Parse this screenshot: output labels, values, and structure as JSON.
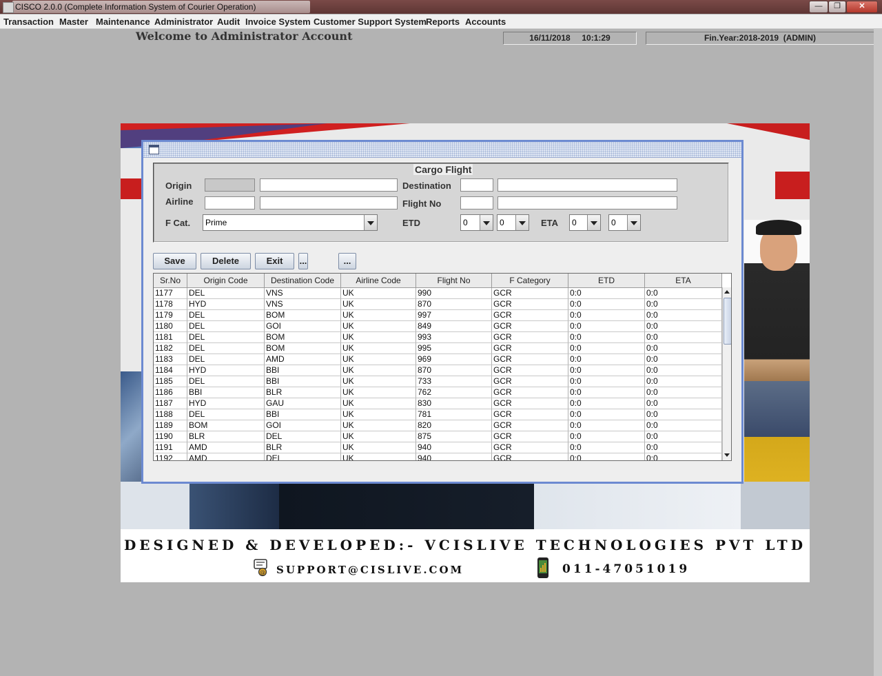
{
  "window": {
    "title": "CISCO 2.0.0 (Complete Information System of Courier Operation)",
    "minimize_icon": "minimize-icon",
    "restore_icon": "restore-icon",
    "close_icon": "close-icon"
  },
  "menu": [
    "Transaction",
    "Master",
    "Maintenance",
    "Administrator",
    "Audit",
    "Invoice System",
    "Customer Support System",
    "Reports",
    "Accounts"
  ],
  "welcome": "Welcome to Administrator Account",
  "datetime": "16/11/2018     10:1:29",
  "finyear": "Fin.Year:2018-2019  (ADMIN)",
  "banner": {
    "designed": "DESIGNED & DEVELOPED:- VCISLIVE TECHNOLOGIES PVT LTD",
    "email": "SUPPORT@CISLIVE.COM",
    "phone": "011-47051019"
  },
  "form": {
    "legend": "Cargo Flight",
    "labels": {
      "origin": "Origin",
      "destination": "Destination",
      "airline": "Airline",
      "flight_no": "Flight No",
      "fcat": "F Cat.",
      "etd": "ETD",
      "eta": "ETA"
    },
    "fcat_value": "Prime",
    "etd_hour": "0",
    "etd_min": "0",
    "eta_hour": "0",
    "eta_min": "0",
    "buttons": {
      "save": "Save",
      "delete": "Delete",
      "exit": "Exit",
      "more1": "...",
      "more2": "..."
    }
  },
  "table": {
    "columns": [
      "Sr.No",
      "Origin Code",
      "Destination Code",
      "Airline Code",
      "Flight No",
      "F Category",
      "ETD",
      "ETA"
    ],
    "rows": [
      [
        "1177",
        "DEL",
        "VNS",
        "UK",
        "990",
        "GCR",
        "0:0",
        "0:0"
      ],
      [
        "1178",
        "HYD",
        "VNS",
        "UK",
        "870",
        "GCR",
        "0:0",
        "0:0"
      ],
      [
        "1179",
        "DEL",
        "BOM",
        "UK",
        "997",
        "GCR",
        "0:0",
        "0:0"
      ],
      [
        "1180",
        "DEL",
        "GOI",
        "UK",
        "849",
        "GCR",
        "0:0",
        "0:0"
      ],
      [
        "1181",
        "DEL",
        "BOM",
        "UK",
        "993",
        "GCR",
        "0:0",
        "0:0"
      ],
      [
        "1182",
        "DEL",
        "BOM",
        "UK",
        "995",
        "GCR",
        "0:0",
        "0:0"
      ],
      [
        "1183",
        "DEL",
        "AMD",
        "UK",
        "969",
        "GCR",
        "0:0",
        "0:0"
      ],
      [
        "1184",
        "HYD",
        "BBI",
        "UK",
        "870",
        "GCR",
        "0:0",
        "0:0"
      ],
      [
        "1185",
        "DEL",
        "BBI",
        "UK",
        "733",
        "GCR",
        "0:0",
        "0:0"
      ],
      [
        "1186",
        "BBI",
        "BLR",
        "UK",
        "762",
        "GCR",
        "0:0",
        "0:0"
      ],
      [
        "1187",
        "HYD",
        "GAU",
        "UK",
        "830",
        "GCR",
        "0:0",
        "0:0"
      ],
      [
        "1188",
        "DEL",
        "BBI",
        "UK",
        "781",
        "GCR",
        "0:0",
        "0:0"
      ],
      [
        "1189",
        "BOM",
        "GOI",
        "UK",
        "820",
        "GCR",
        "0:0",
        "0:0"
      ],
      [
        "1190",
        "BLR",
        "DEL",
        "UK",
        "875",
        "GCR",
        "0:0",
        "0:0"
      ],
      [
        "1191",
        "AMD",
        "BLR",
        "UK",
        "940",
        "GCR",
        "0:0",
        "0:0"
      ],
      [
        "1192",
        "AMD",
        "DEL",
        "UK",
        "940",
        "GCR",
        "0:0",
        "0:0"
      ]
    ]
  }
}
